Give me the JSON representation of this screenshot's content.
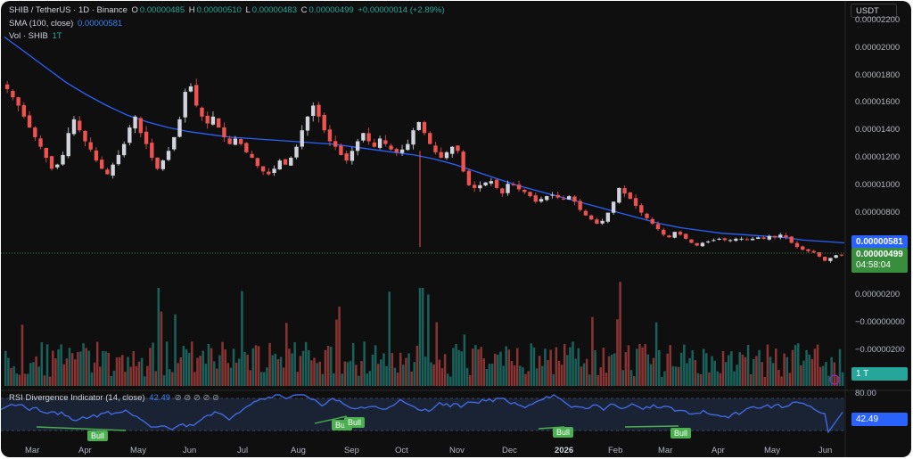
{
  "header": {
    "symbol": "SHIB / TetherUS · 1D · Binance",
    "open_label": "O",
    "open": "0.00000485",
    "high_label": "H",
    "high": "0.00000510",
    "low_label": "L",
    "low": "0.00000483",
    "close_label": "C",
    "close": "0.00000499",
    "change": "+0.00000014 (+2.89%)",
    "sma_label": "SMA (100, close)",
    "sma_value": "0.00000581",
    "vol_label": "Vol · SHIB",
    "vol_value": "1T",
    "currency": "USDT"
  },
  "price_axis": {
    "ticks": [
      "0.00002200",
      "0.00002000",
      "0.00001800",
      "0.00001600",
      "0.00001400",
      "0.00001200",
      "0.00001000",
      "0.00000800",
      "0.00000600",
      "0.00000400",
      "0.00000200",
      "−0.00000000",
      "−0.00000200",
      "−0.00000400"
    ],
    "sma_box": "0.00000581",
    "price_box": "0.00000499",
    "countdown": "04:58:04",
    "vol_box": "1 T"
  },
  "rsi": {
    "label": "RSI Divergence Indicator (14, close)",
    "value": "42.49",
    "glyphs": "⊘ ⊘ ⊘ ⊘ ⊘",
    "upper_tick": "80.00",
    "badge": "42.49",
    "bull_labels": [
      "Bull",
      "Bull",
      "Bull",
      "Bull",
      "Bull"
    ]
  },
  "time_axis": [
    "Mar",
    "Apr",
    "May",
    "Jun",
    "Jul",
    "Aug",
    "Sep",
    "Oct",
    "Nov",
    "Dec",
    "2026",
    "Feb",
    "Mar",
    "Apr",
    "May",
    "Jun"
  ],
  "colors": {
    "up": "#26a69a",
    "down": "#ef5350",
    "sma": "#2962ff",
    "rsi": "#3b5bdb",
    "bull": "#4caf50",
    "bg": "#0f0f0f"
  },
  "chart_data": {
    "type": "candlestick",
    "series": [
      {
        "name": "SHIB / TetherUS",
        "type": "ohlc-close",
        "close": [
          1.7e-05,
          1.64e-05,
          1.58e-05,
          1.5e-05,
          1.42e-05,
          1.35e-05,
          1.28e-05,
          1.2e-05,
          1.12e-05,
          1.15e-05,
          1.22e-05,
          1.38e-05,
          1.48e-05,
          1.4e-05,
          1.32e-05,
          1.26e-05,
          1.18e-05,
          1.12e-05,
          1.08e-05,
          1.15e-05,
          1.22e-05,
          1.3e-05,
          1.42e-05,
          1.5e-05,
          1.38e-05,
          1.3e-05,
          1.2e-05,
          1.12e-05,
          1.18e-05,
          1.25e-05,
          1.35e-05,
          1.48e-05,
          1.68e-05,
          1.72e-05,
          1.58e-05,
          1.5e-05,
          1.45e-05,
          1.5e-05,
          1.42e-05,
          1.35e-05,
          1.3e-05,
          1.34e-05,
          1.3e-05,
          1.24e-05,
          1.2e-05,
          1.14e-05,
          1.1e-05,
          1.08e-05,
          1.12e-05,
          1.18e-05,
          1.15e-05,
          1.2e-05,
          1.28e-05,
          1.4e-05,
          1.5e-05,
          1.58e-05,
          1.5e-05,
          1.4e-05,
          1.32e-05,
          1.28e-05,
          1.22e-05,
          1.18e-05,
          1.25e-05,
          1.32e-05,
          1.38e-05,
          1.32e-05,
          1.28e-05,
          1.34e-05,
          1.3e-05,
          1.26e-05,
          1.24e-05,
          1.26e-05,
          1.3e-05,
          1.4e-05,
          1.46e-05,
          1.38e-05,
          1.3e-05,
          1.24e-05,
          1.2e-05,
          1.24e-05,
          1.28e-05,
          1.25e-05,
          1.1e-05,
          1e-05,
          9.8e-06,
          1e-05,
          1.02e-05,
          1.03e-05,
          9.8e-06,
          9.4e-06,
          1.01e-05,
          1e-05,
          9.7e-06,
          9.5e-06,
          9.2e-06,
          8.8e-06,
          9e-06,
          9.2e-06,
          9.3e-06,
          9.1e-06,
          9e-06,
          9.2e-06,
          8.8e-06,
          8.2e-06,
          7.8e-06,
          7.5e-06,
          7.2e-06,
          7.4e-06,
          8e-06,
          8.8e-06,
          9.8e-06,
          9.4e-06,
          9e-06,
          8.5e-06,
          8e-06,
          7.6e-06,
          7.2e-06,
          6.8e-06,
          6.4e-06,
          6.2e-06,
          6.6e-06,
          6.4e-06,
          6.1e-06,
          5.8e-06,
          5.6e-06,
          5.8e-06,
          5.9e-06,
          6e-06,
          6.1e-06,
          6e-06,
          6e-06,
          6.1e-06,
          6.1e-06,
          6e-06,
          6.1e-06,
          6.2e-06,
          6.1e-06,
          6.3e-06,
          6.2e-06,
          6.4e-06,
          6.2e-06,
          5.8e-06,
          5.5e-06,
          5.3e-06,
          5.2e-06,
          5.1e-06,
          4.8e-06,
          4.5e-06,
          4.7e-06,
          4.9e-06,
          4.9e-06
        ]
      },
      {
        "name": "SMA (100, close)",
        "type": "line",
        "values": [
          2.08e-05,
          1.97e-05,
          1.86e-05,
          1.75e-05,
          1.66e-05,
          1.58e-05,
          1.51e-05,
          1.46e-05,
          1.42e-05,
          1.39e-05,
          1.37e-05,
          1.35e-05,
          1.34e-05,
          1.33e-05,
          1.32e-05,
          1.31e-05,
          1.3e-05,
          1.28e-05,
          1.26e-05,
          1.24e-05,
          1.22e-05,
          1.19e-05,
          1.15e-05,
          1.1e-05,
          1.05e-05,
          1e-05,
          9.6e-06,
          9.2e-06,
          8.8e-06,
          8.4e-06,
          8e-06,
          7.6e-06,
          7.2e-06,
          6.9e-06,
          6.7e-06,
          6.5e-06,
          6.4e-06,
          6.3e-06,
          6.2e-06,
          6e-06,
          5.9e-06,
          5.8e-06
        ]
      },
      {
        "name": "Vol · SHIB",
        "type": "bar"
      },
      {
        "name": "RSI Divergence Indicator (14, close)",
        "type": "line"
      }
    ],
    "x_labels": [
      "Mar",
      "Apr",
      "May",
      "Jun",
      "Jul",
      "Aug",
      "Sep",
      "Oct",
      "Nov",
      "Dec",
      "2026",
      "Feb",
      "Mar",
      "Apr",
      "May",
      "Jun"
    ],
    "last_close": 4.99e-06,
    "rsi_last": 42.49
  }
}
